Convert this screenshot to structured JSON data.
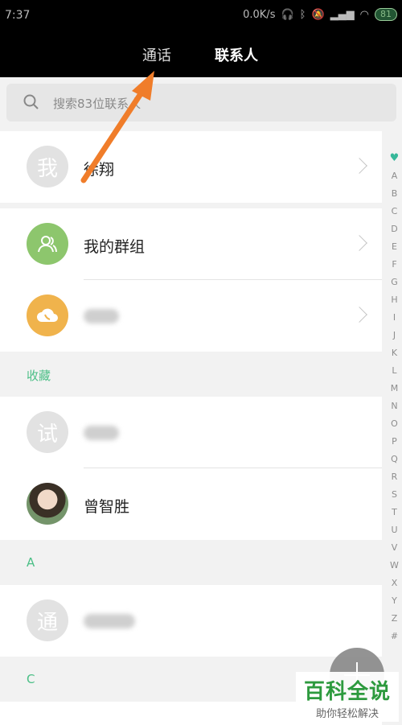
{
  "status_bar": {
    "time": "7:37",
    "speed": "0.0K/s",
    "battery": "81"
  },
  "tabs": {
    "calls": "通话",
    "contacts": "联系人"
  },
  "search": {
    "placeholder": "搜索83位联系人"
  },
  "rows": {
    "me": {
      "avatar": "我",
      "name": "徐翔"
    },
    "groups": {
      "name": "我的群组"
    },
    "cloud": {
      "name": ""
    }
  },
  "sections": {
    "favorites": "收藏",
    "a": "A",
    "c": "C"
  },
  "favorites": [
    {
      "avatar": "试",
      "name": ""
    },
    {
      "avatar": "",
      "name": "曾智胜"
    }
  ],
  "a_contacts": [
    {
      "avatar": "通",
      "name": ""
    }
  ],
  "index_letters": [
    "A",
    "B",
    "C",
    "D",
    "E",
    "F",
    "G",
    "H",
    "I",
    "J",
    "K",
    "L",
    "M",
    "N",
    "O",
    "P",
    "Q",
    "R",
    "S",
    "T",
    "U",
    "V",
    "W",
    "X",
    "Y",
    "Z",
    "#"
  ],
  "watermark": {
    "title": "百科全说",
    "subtitle": "助你轻松解决"
  },
  "colors": {
    "accent": "#4bbf86",
    "arrow": "#f07d2a",
    "group_avatar": "#8dc66d",
    "cloud_avatar": "#f0b34c"
  }
}
